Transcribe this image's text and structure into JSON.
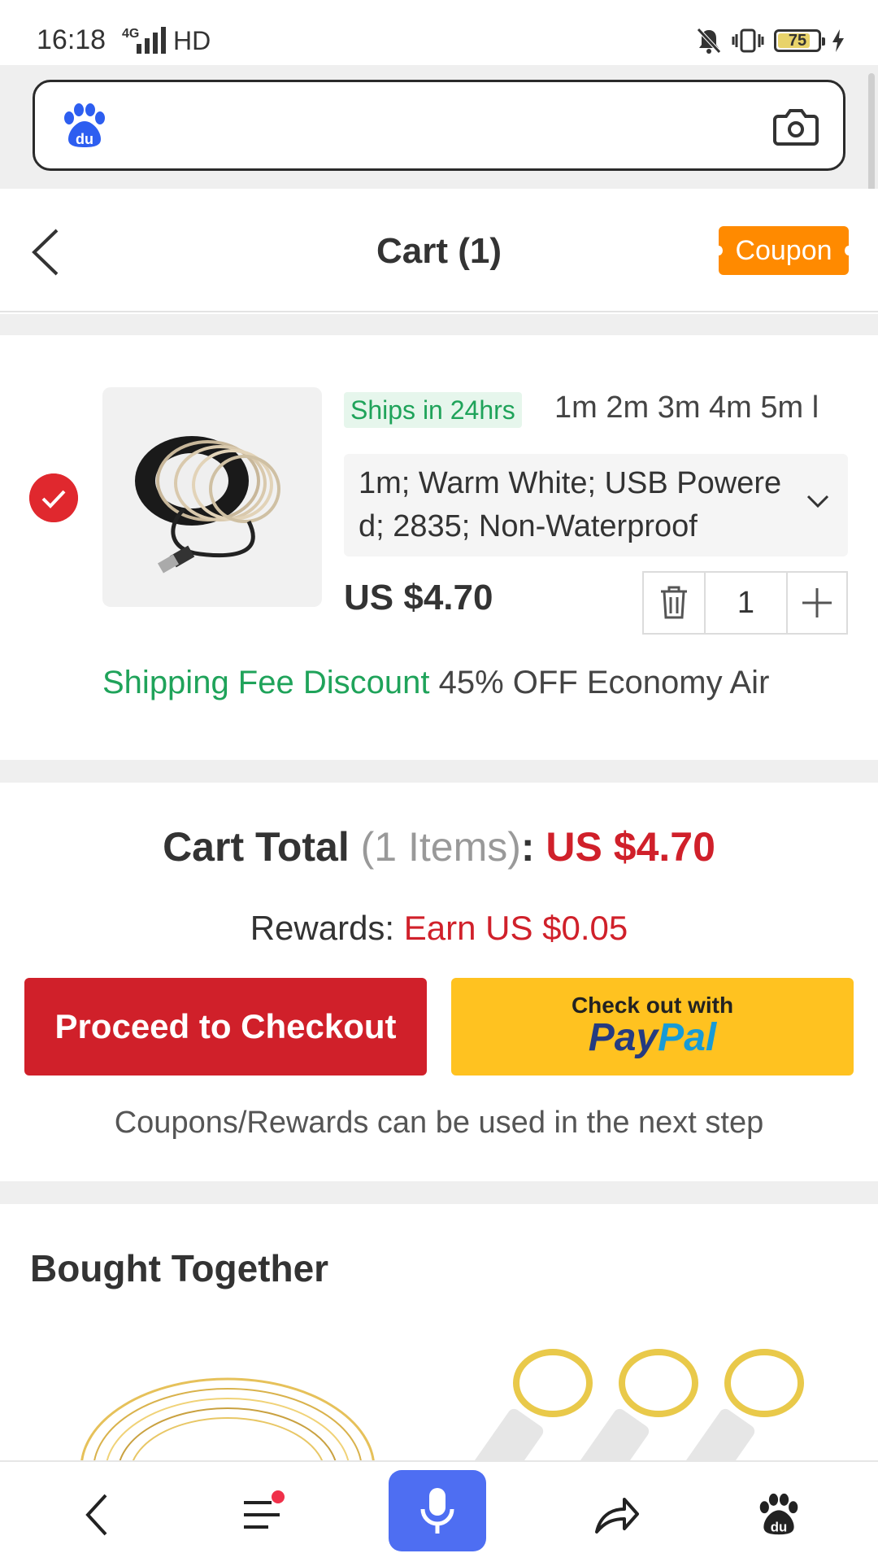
{
  "status_bar": {
    "time": "16:18",
    "network": "4G",
    "hd": "HD",
    "battery": "75"
  },
  "search": {
    "placeholder": ""
  },
  "header": {
    "title": "Cart (1)",
    "coupon_label": "Coupon"
  },
  "cart_item": {
    "ships_badge": "Ships in 24hrs",
    "variants": "1m 2m 3m 4m 5m l",
    "selected_sku": "1m; Warm White; USB Powered; 2835; Non-Waterproof",
    "price": "US $4.70",
    "quantity": "1",
    "shipping_discount_label": "Shipping Fee Discount",
    "shipping_discount_text": "45% OFF Economy Air",
    "checked": true
  },
  "totals": {
    "label": "Cart Total",
    "items": "(1 Items)",
    "colon": ": ",
    "amount": "US $4.70",
    "rewards_label": "Rewards: ",
    "rewards_value": "Earn US $0.05",
    "checkout_label": "Proceed to Checkout",
    "paypal_top": "Check out with",
    "paypal_pay": "Pay",
    "paypal_pal": "Pal",
    "note": "Coupons/Rewards can be used in the next step"
  },
  "bought_together": {
    "title": "Bought Together"
  },
  "colors": {
    "accent_red": "#d0202a",
    "coupon_orange": "#ff8a00",
    "paypal_yellow": "#ffc220",
    "green": "#1fa35a",
    "mic_blue": "#4e6ef2"
  },
  "bottom_nav": {
    "icons": [
      "back-icon",
      "menu-icon",
      "microphone-icon",
      "share-icon",
      "baidu-paw-icon"
    ]
  }
}
